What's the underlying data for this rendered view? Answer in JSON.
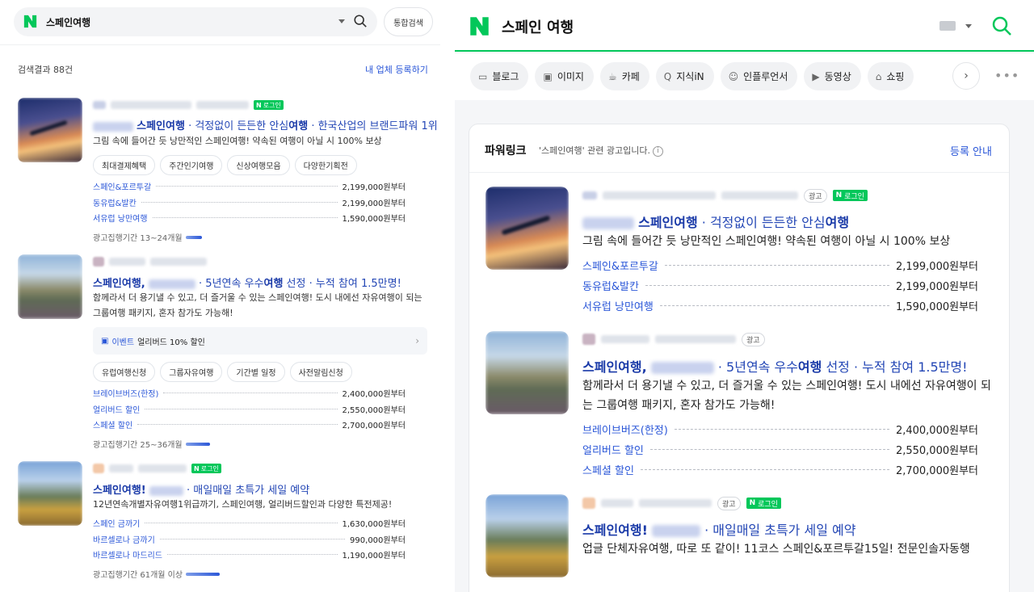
{
  "left": {
    "search": {
      "query": "스페인여행",
      "total_search_label": "통합검색"
    },
    "results_count": "검색결과 88건",
    "register_link": "내 업체 등록하기",
    "login_badge": "로그인",
    "ads": [
      {
        "title_bold": "스페인여행",
        "title_rest": " · 걱정없이 든든한 안심",
        "title_bold2": "여행",
        "title_rest2": " · 한국산업의 브랜드파워 1위",
        "desc": "그림 속에 들어간 듯 낭만적인 스페인여행! 약속된 여행이 아닐 시 100% 보상",
        "chips": [
          "최대결제혜택",
          "주간인기여행",
          "신상여행모음",
          "다양한기획전"
        ],
        "links": [
          {
            "name": "스페인&포르투갈",
            "price": "2,199,000원부터"
          },
          {
            "name": "동유럽&발칸",
            "price": "2,199,000원부터"
          },
          {
            "name": "서유럽 낭만여행",
            "price": "1,590,000원부터"
          }
        ],
        "period": "광고집행기간 13~24개월"
      },
      {
        "title_bold": "스페인여행,",
        "title_rest": " · 5년연속 우수",
        "title_bold2": "여행",
        "title_rest2": " 선정 · 누적 참여 1.5만명!",
        "desc_line1": "함께라서 더 용기낼 수 있고, 더 즐거울 수 있는 스페인여행! 도시 내에선 자유여행이 되는",
        "desc_line2": "그룹여행 패키지, 혼자 참가도 가능해!",
        "event_label": "이벤트",
        "event_text": "얼리버드 10% 할인",
        "chips": [
          "유럽여행신청",
          "그룹자유여행",
          "기간별 일정",
          "사전알림신청"
        ],
        "links": [
          {
            "name": "브레이브버즈(한정)",
            "price": "2,400,000원부터"
          },
          {
            "name": "얼리버드 할인",
            "price": "2,550,000원부터"
          },
          {
            "name": "스페셜 할인",
            "price": "2,700,000원부터"
          }
        ],
        "period": "광고집행기간 25~36개월"
      },
      {
        "title_bold": "스페인여행!",
        "title_rest": " · 매일매일 초특가 세일 예약",
        "desc": "12년연속개별자유여행1위급까기, 스페인여행, 얼리버드할인과 다양한 특전제공!",
        "links": [
          {
            "name": "스페인 금까기",
            "price": "1,630,000원부터"
          },
          {
            "name": "바르셀로나 금까기",
            "price": "990,000원부터"
          },
          {
            "name": "바르셀로나 마드리드",
            "price": "1,190,000원부터"
          }
        ],
        "period": "광고집행기간 61개월 이상"
      }
    ]
  },
  "right": {
    "query": "스페인 여행",
    "tabs": [
      {
        "icon": "blog-icon",
        "glyph": "▭",
        "label": "블로그"
      },
      {
        "icon": "image-icon",
        "glyph": "▣",
        "label": "이미지"
      },
      {
        "icon": "cafe-icon",
        "glyph": "☕",
        "label": "카페"
      },
      {
        "icon": "knowledge-icon",
        "glyph": "Q",
        "label": "지식iN"
      },
      {
        "icon": "influencer-icon",
        "glyph": "☺",
        "label": "인플루언서"
      },
      {
        "icon": "video-icon",
        "glyph": "▶",
        "label": "동영상"
      },
      {
        "icon": "shopping-icon",
        "glyph": "⌂",
        "label": "쇼핑"
      }
    ],
    "powerlink_title": "파워링크",
    "powerlink_sub": "'스페인여행' 관련 광고입니다.",
    "guide_link": "등록 안내",
    "ad_badge": "광고",
    "login_badge": "로그인",
    "ads": [
      {
        "title_bold": "스페인여행",
        "title_rest": " · 걱정없이 든든한 안심",
        "title_bold2": "여행",
        "desc": "그림 속에 들어간 듯 낭만적인 스페인여행! 약속된 여행이 아닐 시 100% 보상",
        "links": [
          {
            "name": "스페인&포르투갈",
            "price": "2,199,000원부터"
          },
          {
            "name": "동유럽&발칸",
            "price": "2,199,000원부터"
          },
          {
            "name": "서유럽 낭만여행",
            "price": "1,590,000원부터"
          }
        ]
      },
      {
        "title_bold": "스페인여행,",
        "title_rest": " · 5년연속 우수",
        "title_bold2": "여행",
        "title_rest2": " 선정 · 누적 참여 1.5만명!",
        "desc": "함께라서 더 용기낼 수 있고, 더 즐거울 수 있는 스페인여행! 도시 내에선 자유여행이 되는 그룹여행 패키지, 혼자 참가도 가능해!",
        "links": [
          {
            "name": "브레이브버즈(한정)",
            "price": "2,400,000원부터"
          },
          {
            "name": "얼리버드 할인",
            "price": "2,550,000원부터"
          },
          {
            "name": "스페셜 할인",
            "price": "2,700,000원부터"
          }
        ]
      },
      {
        "title_bold": "스페인여행!",
        "title_rest": " · 매일매일 초특가 세일 예약",
        "desc": "업글 단체자유여행, 따로 또 같이! 11코스 스페인&포르투갈15일! 전문인솔자동행"
      }
    ]
  },
  "colors": {
    "naver_green": "#03c75a",
    "link_blue": "#2b57d8",
    "title_blue": "#1a3aa8"
  }
}
